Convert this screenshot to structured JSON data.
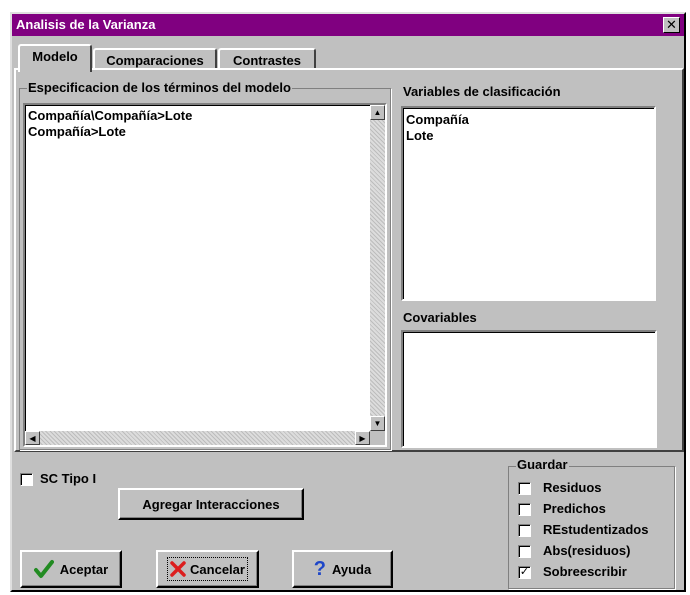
{
  "dialog": {
    "title": "Analisis de la Varianza",
    "close_glyph": "✕"
  },
  "tabs": [
    {
      "label": "Modelo",
      "active": true
    },
    {
      "label": "Comparaciones",
      "active": false
    },
    {
      "label": "Contrastes",
      "active": false
    }
  ],
  "model_terms": {
    "legend": "Especificacion de los términos del modelo",
    "items": [
      "Compañía\\Compañía>Lote",
      "Compañía>Lote"
    ]
  },
  "classification": {
    "label": "Variables de clasificación",
    "items": [
      "Compañía",
      "Lote"
    ]
  },
  "covariables": {
    "label": "Covariables",
    "items": []
  },
  "sc_tipo": {
    "label": "SC Tipo I",
    "checked": false
  },
  "add_interactions_label": "Agregar Interacciones",
  "guardar": {
    "legend": "Guardar",
    "options": [
      {
        "label": "Residuos",
        "checked": false
      },
      {
        "label": "Predichos",
        "checked": false
      },
      {
        "label": "REstudentizados",
        "checked": false
      },
      {
        "label": "Abs(residuos)",
        "checked": false
      },
      {
        "label": "Sobreescribir",
        "checked": true
      }
    ]
  },
  "buttons": {
    "accept": "Aceptar",
    "cancel": "Cancelar",
    "help": "Ayuda"
  },
  "icons": {
    "accept": "checkmark-icon",
    "cancel": "x-icon",
    "help": "question-icon",
    "check_glyph": "✓"
  },
  "colors": {
    "title_bar": "#800080",
    "face": "#c0c0c0",
    "accept_icon": "#228b22",
    "cancel_icon": "#dc1e1e",
    "help_icon": "#1e46c8"
  }
}
